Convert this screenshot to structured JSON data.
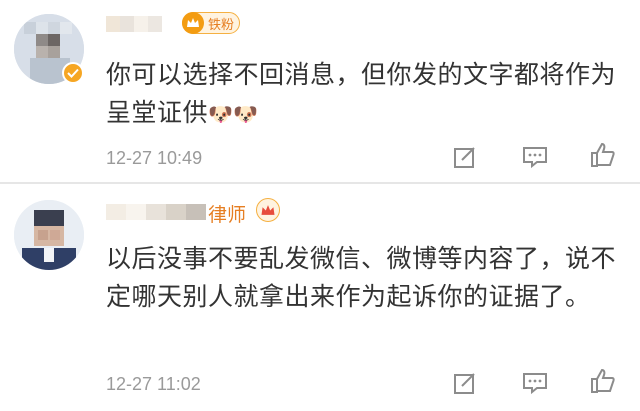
{
  "comments": [
    {
      "badge_label": "铁粉",
      "text": "你可以选择不回消息，但你发的文字都将作为呈堂证供",
      "emoji": "🐶🐶",
      "timestamp": "12-27 10:49"
    },
    {
      "name_suffix": "律师",
      "text": "以后没事不要乱发微信、微博等内容了，说不定哪天别人就拿出来作为起诉你的证据了。",
      "timestamp": "12-27 11:02"
    }
  ],
  "icons": {
    "edit": "edit-icon",
    "reply": "comment-icon",
    "like": "thumbs-up-icon",
    "verified": "verified-icon",
    "crown": "crown-icon"
  },
  "colors": {
    "badge_orange": "#f39c12",
    "timestamp_gray": "#9a9a9a",
    "text": "#333333"
  }
}
